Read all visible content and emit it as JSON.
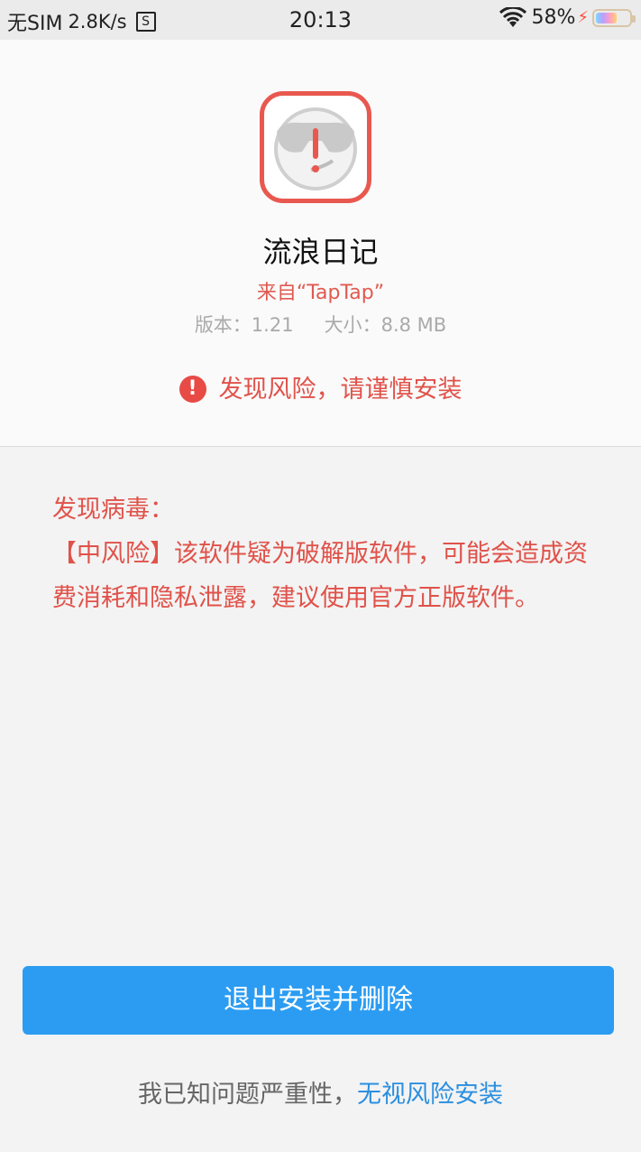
{
  "status_bar": {
    "sim": "无SIM",
    "speed": "2.8K/s",
    "s_badge": "S",
    "time": "20:13",
    "battery": "58%"
  },
  "app": {
    "name": "流浪日记",
    "source": "来自“TapTap”",
    "version": "版本：1.21",
    "size": "大小：8.8 MB",
    "risk_summary": "发现风险，请谨慎安装"
  },
  "warning": {
    "heading": "发现病毒：",
    "body": "【中风险】该软件疑为破解版软件，可能会造成资费消耗和隐私泄露，建议使用官方正版软件。"
  },
  "actions": {
    "primary": "退出安装并删除",
    "ignore_prefix": "我已知问题严重性，",
    "ignore_link": "无视风险安装"
  },
  "colors": {
    "accent_red": "#e0524a",
    "primary_blue": "#2b9cf2",
    "link_blue": "#2b8fe0"
  },
  "icons": [
    "wifi-icon",
    "battery-icon",
    "alert-icon",
    "app-icon"
  ]
}
